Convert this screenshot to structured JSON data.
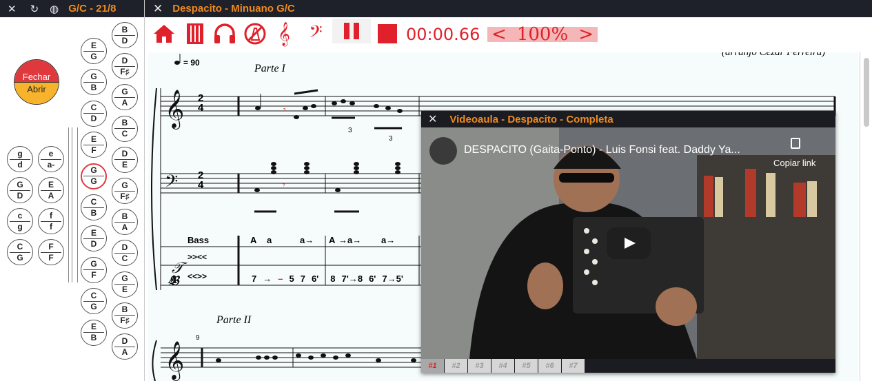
{
  "left_panel": {
    "title": "G/C - 21/8",
    "icons": [
      "close-icon",
      "refresh-icon",
      "globe-icon"
    ],
    "fechar": "Fechar",
    "abrir": "Abrir",
    "right_column": [
      {
        "top": "B",
        "bottom": "D"
      },
      {
        "top": "D",
        "bottom": "F♯"
      },
      {
        "top": "G",
        "bottom": "A"
      },
      {
        "top": "B",
        "bottom": "C"
      },
      {
        "top": "D",
        "bottom": "E"
      },
      {
        "top": "G",
        "bottom": "F♯"
      },
      {
        "top": "B",
        "bottom": "A"
      },
      {
        "top": "D",
        "bottom": "C"
      },
      {
        "top": "G",
        "bottom": "E"
      },
      {
        "top": "B",
        "bottom": "F♯"
      },
      {
        "top": "D",
        "bottom": "A"
      }
    ],
    "middle_column": [
      {
        "top": "E",
        "bottom": "G"
      },
      {
        "top": "G",
        "bottom": "B"
      },
      {
        "top": "C",
        "bottom": "D"
      },
      {
        "top": "E",
        "bottom": "F"
      },
      {
        "top": "G",
        "bottom": "G"
      },
      {
        "top": "C",
        "bottom": "B"
      },
      {
        "top": "E",
        "bottom": "D"
      },
      {
        "top": "G",
        "bottom": "F"
      },
      {
        "top": "C",
        "bottom": "G"
      },
      {
        "top": "E",
        "bottom": "B"
      }
    ],
    "bass_left": [
      {
        "top": "g",
        "bottom": "d"
      },
      {
        "top": "G",
        "bottom": "D"
      },
      {
        "top": "c",
        "bottom": "g"
      },
      {
        "top": "C",
        "bottom": "G"
      }
    ],
    "bass_right": [
      {
        "top": "e",
        "bottom": "a-"
      },
      {
        "top": "E",
        "bottom": "A"
      },
      {
        "top": "f",
        "bottom": "f"
      },
      {
        "top": "F",
        "bottom": "F"
      }
    ]
  },
  "main": {
    "title": "Despacito - Minuano G/C",
    "toolbar_icons": [
      "home-icon",
      "accordion-icon",
      "headphones-icon",
      "no-metronome-icon",
      "treble-clef-icon",
      "bass-clef-icon",
      "pause-icon",
      "stop-icon"
    ],
    "time": "00:00.66",
    "zoom": "100%",
    "zoom_prev": "<",
    "zoom_next": ">"
  },
  "score": {
    "tempo": "= 90",
    "credit": "(arranjo Cezar Ferreira)",
    "part1": "Parte I",
    "part2": "Parte II",
    "measure_number": "9",
    "time_sig_top": "2",
    "time_sig_bottom": "4",
    "triplet": "3",
    "bass_label": "Bass",
    "row1_label": ">><<",
    "row2_label": "<<>>",
    "bass_notes": [
      "A",
      "a",
      "a→",
      "A",
      "→a→",
      "a→"
    ],
    "tab_numbers": [
      "7",
      "→",
      "–",
      "5",
      "7",
      "6'",
      "8",
      "7'→8",
      "6'",
      "7→5'"
    ]
  },
  "video": {
    "title": "Videoaula - Despacito - Completa",
    "yt_title": "DESPACITO (Gaita-Ponto) - Luis Fonsi feat. Daddy Ya...",
    "copy_link": "Copiar link",
    "tabs": [
      "#1",
      "#2",
      "#3",
      "#4",
      "#5",
      "#6",
      "#7"
    ]
  },
  "colors": {
    "accent": "#f08a1e",
    "toolbar_red": "#e0202a",
    "titlebar": "#1e2129",
    "selected": "#e0393d"
  }
}
